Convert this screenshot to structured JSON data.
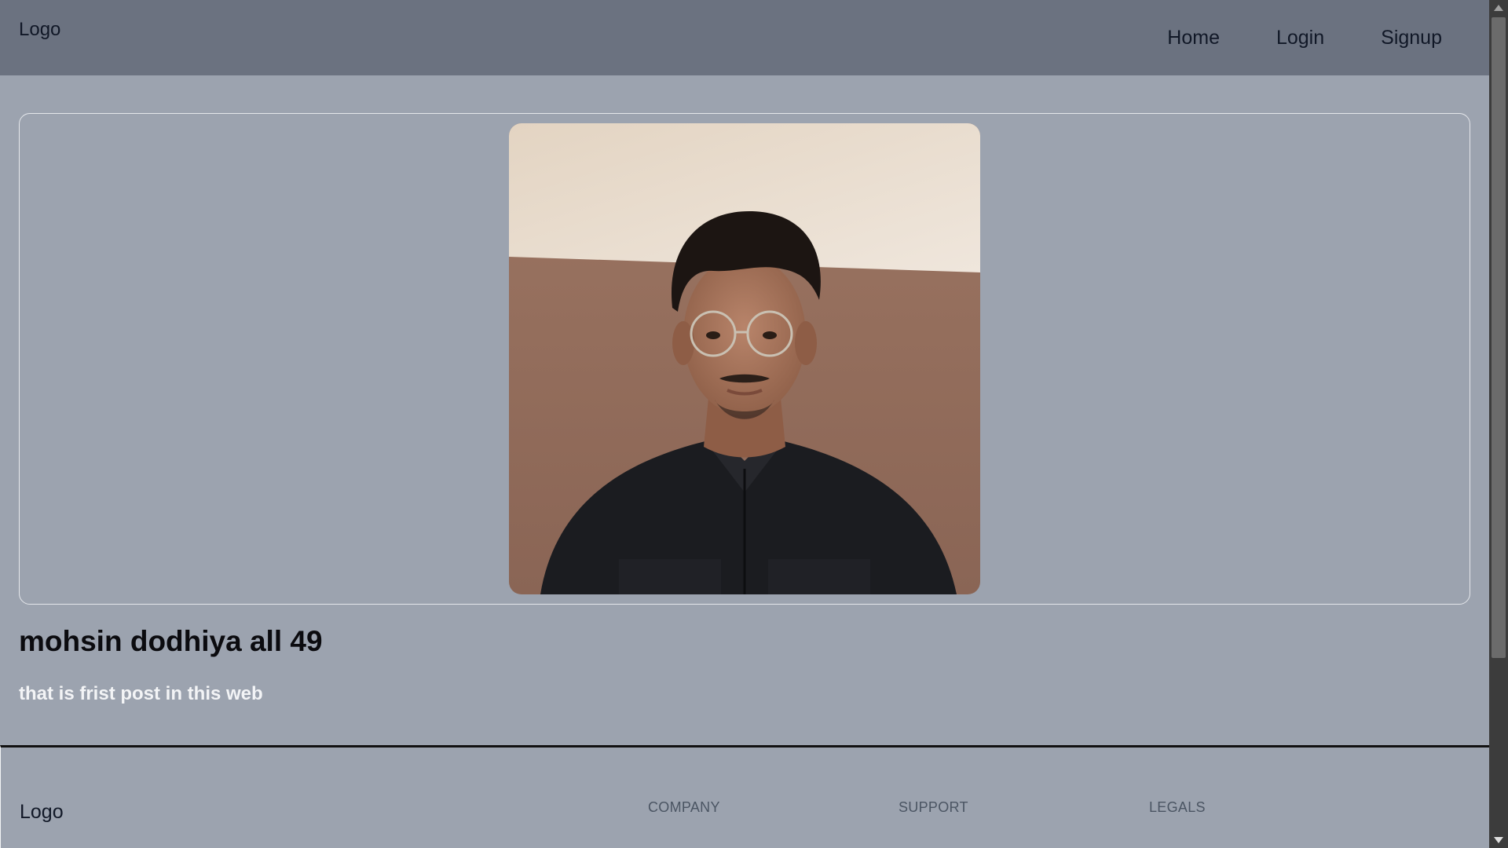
{
  "header": {
    "logo": "Logo",
    "nav": [
      "Home",
      "Login",
      "Signup"
    ]
  },
  "post": {
    "title": "mohsin dodhiya all 49",
    "body": "that is frist post in this web"
  },
  "footer": {
    "logo": "Logo",
    "columns": [
      "COMPANY",
      "SUPPORT",
      "LEGALS"
    ]
  },
  "colors": {
    "header_bg": "#6b7280",
    "page_bg": "#9ca3af",
    "text_dark": "#111827",
    "text_light": "#f3f4f6"
  }
}
